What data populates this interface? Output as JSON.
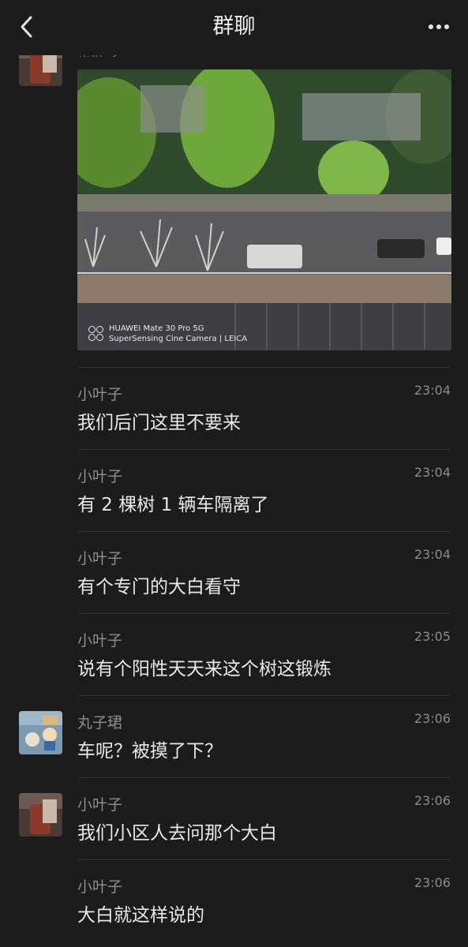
{
  "header": {
    "title": "群聊"
  },
  "previous_sender_name_cut": "小叶子",
  "photo": {
    "camera_line1": "HUAWEI Mate 30 Pro 5G",
    "camera_line2": "SuperSensing Cine Camera | LEICA"
  },
  "messages": [
    {
      "name": "小叶子",
      "time": "23:04",
      "text": "我们后门这里不要来"
    },
    {
      "name": "小叶子",
      "time": "23:04",
      "text": "有 2 棵树 1 辆车隔离了"
    },
    {
      "name": "小叶子",
      "time": "23:04",
      "text": "有个专门的大白看守"
    },
    {
      "name": "小叶子",
      "time": "23:05",
      "text": "说有个阳性天天来这个树这锻炼"
    },
    {
      "name": "丸子珺",
      "time": "23:06",
      "text": "车呢？被摸了下？"
    },
    {
      "name": "小叶子",
      "time": "23:06",
      "text": "我们小区人去问那个大白"
    },
    {
      "name": "小叶子",
      "time": "23:06",
      "text": "大白就这样说的"
    }
  ],
  "colors": {
    "background": "#1c1c1c",
    "text": "#e8e8e8",
    "muted": "#8d8d8d"
  }
}
